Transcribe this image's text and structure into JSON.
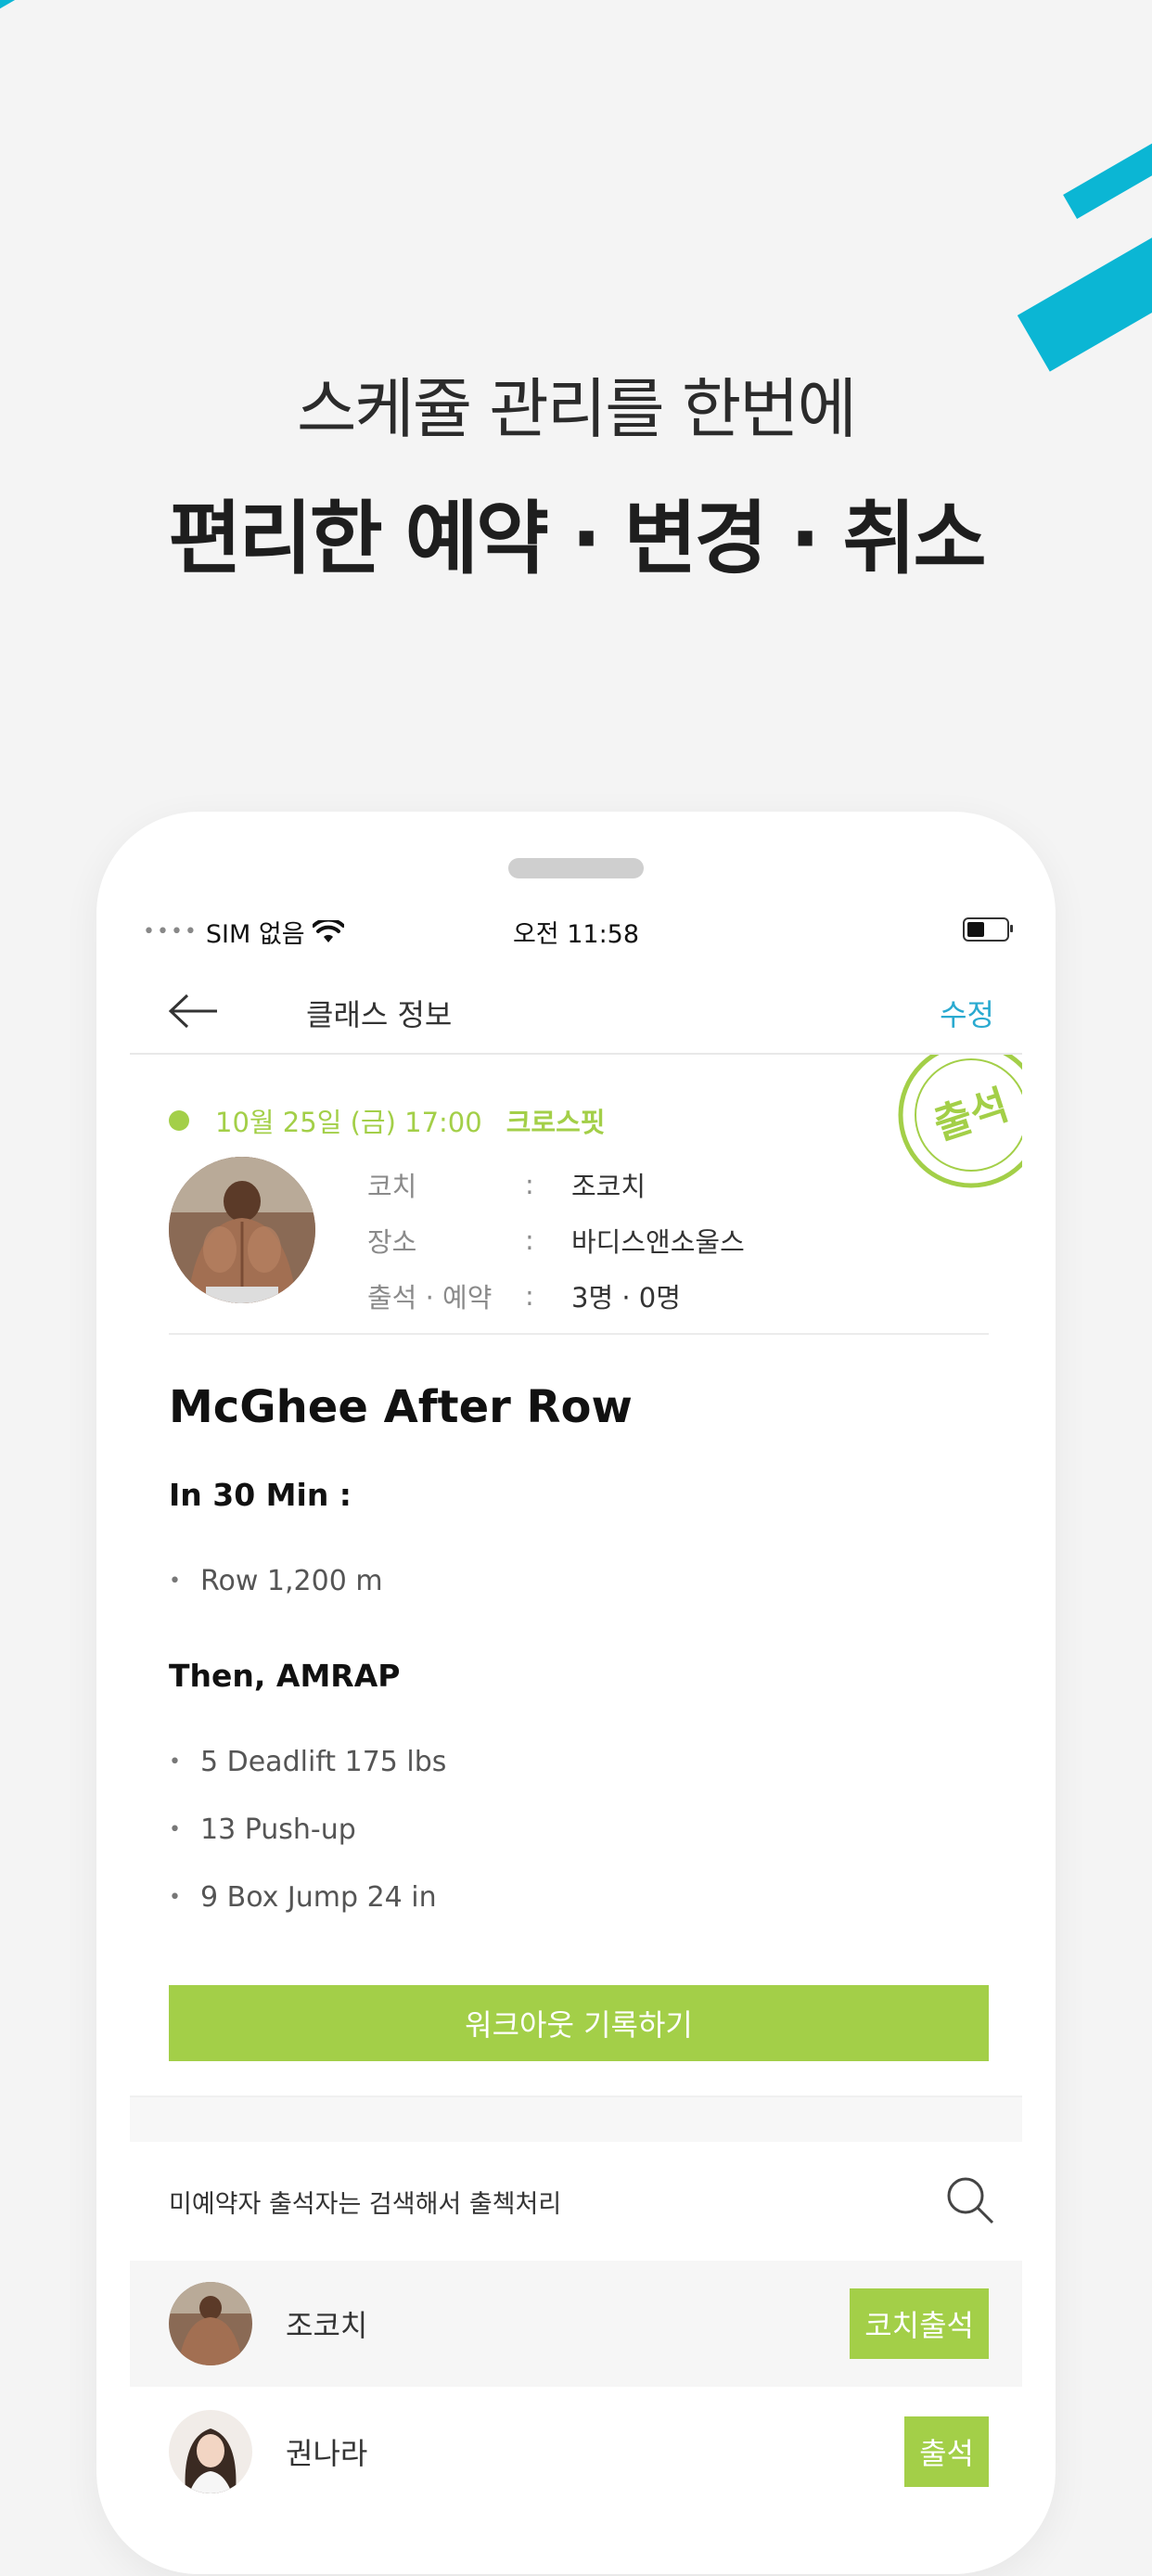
{
  "promo": {
    "line1": "스케쥴 관리를 한번에",
    "line2": "편리한 예약 · 변경 · 취소"
  },
  "status_bar": {
    "carrier": "SIM 없음",
    "time": "오전 11:58"
  },
  "nav": {
    "title": "클래스 정보",
    "edit_label": "수정"
  },
  "stamp": {
    "text": "출석"
  },
  "class_info": {
    "date": "10월 25일 (금) 17:00",
    "class_name": "크로스핏",
    "rows": [
      {
        "label": "코치",
        "colon": ":",
        "value": "조코치"
      },
      {
        "label": "장소",
        "colon": ":",
        "value": "바디스앤소울스"
      },
      {
        "label": "출석 · 예약",
        "colon": ":",
        "value": "3명 · 0명"
      }
    ]
  },
  "workout": {
    "title": "McGhee After Row",
    "section1": "In 30 Min :",
    "items1": [
      "Row 1,200 m"
    ],
    "section2": "Then, AMRAP",
    "items2": [
      "5 Deadlift 175 lbs",
      "13 Push-up",
      "9 Box Jump 24 in"
    ],
    "bullet": "•"
  },
  "record_button": "워크아웃 기록하기",
  "search": {
    "text": "미예약자 출석자는 검색해서 출첵처리"
  },
  "members": [
    {
      "name": "조코치",
      "button": "코치출석"
    },
    {
      "name": "권나라",
      "button": "출석"
    }
  ],
  "colors": {
    "accent_green": "#a3cf48",
    "accent_blue": "#0bb6d4",
    "edit_blue": "#2aaad0"
  }
}
